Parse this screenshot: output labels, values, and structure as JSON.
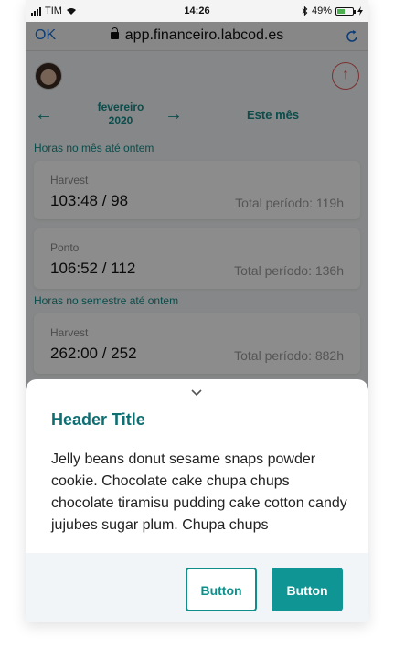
{
  "status_bar": {
    "carrier": "TIM",
    "time": "14:26",
    "battery": "49%",
    "battery_level": 0.49,
    "icons": [
      "signal-icon",
      "wifi-icon",
      "bluetooth-icon",
      "battery-icon",
      "charging-icon"
    ]
  },
  "browser": {
    "ok_label": "OK",
    "url": "app.financeiro.labcod.es",
    "icons": [
      "lock-icon",
      "reload-icon"
    ]
  },
  "header": {
    "month": "fevereiro",
    "year": "2020",
    "current_label": "Este mês",
    "icons": [
      "avatar",
      "upload-icon",
      "arrow-left-icon",
      "arrow-right-icon"
    ]
  },
  "sections": [
    {
      "title": "Horas no mês até ontem",
      "cards": [
        {
          "label": "Harvest",
          "value": "103:48 / 98",
          "total": "Total período: 119h"
        },
        {
          "label": "Ponto",
          "value": "106:52 / 112",
          "total": "Total período: 136h"
        }
      ]
    },
    {
      "title": "Horas no semestre até ontem",
      "cards": [
        {
          "label": "Harvest",
          "value": "262:00 / 252",
          "total": "Total período: 882h"
        }
      ]
    }
  ],
  "sheet": {
    "title": "Header Title",
    "body": "Jelly beans donut sesame snaps powder cookie. Chocolate cake chupa chups chocolate tiramisu pudding cake cotton candy jujubes sugar plum. Chupa chups",
    "secondary_button": "Button",
    "primary_button": "Button"
  },
  "colors": {
    "accent": "#0e9594",
    "title": "#0e6f73",
    "overlay": "rgba(0,0,0,0.45)",
    "danger": "#e25a5a"
  }
}
